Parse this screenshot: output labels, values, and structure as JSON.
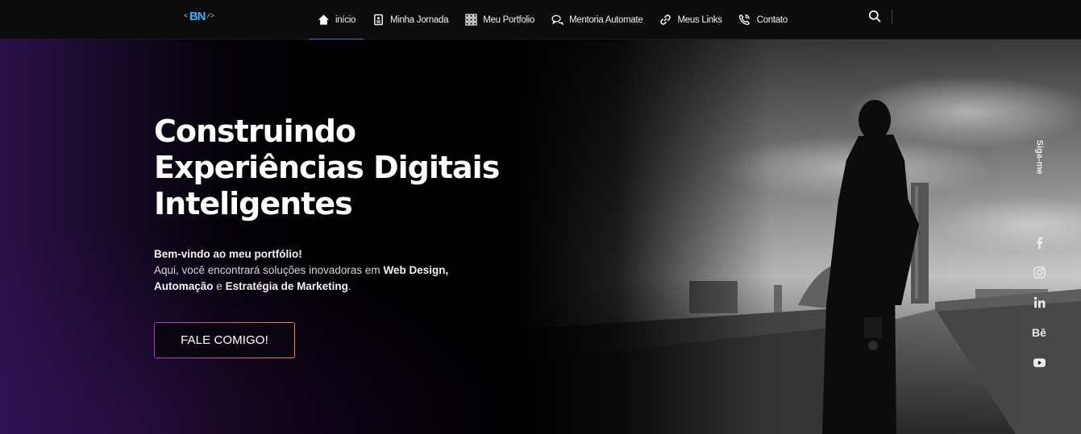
{
  "logo": {
    "left_bracket": "<",
    "mark": "BN",
    "right_bracket": "/>"
  },
  "nav": {
    "items": [
      {
        "label": "início",
        "icon": "home-icon"
      },
      {
        "label": "Minha Jornada",
        "icon": "id-card-icon"
      },
      {
        "label": "Meu Portfolio",
        "icon": "grid-icon"
      },
      {
        "label": "Mentoria Automate",
        "icon": "chat-icon"
      },
      {
        "label": "Meus Links",
        "icon": "link-icon"
      },
      {
        "label": "Contato",
        "icon": "phone-icon"
      }
    ],
    "active_index": 0,
    "accent": "#3d6fe0"
  },
  "hero": {
    "headline_lines": [
      "Construindo",
      "Experiências Digitais",
      "Inteligentes"
    ],
    "intro_welcome": "Bem-vindo ao meu portfólio!",
    "intro_text": "Aqui, você encontrará soluções inovadoras em",
    "intro_highlight_1": "Web Design,",
    "intro_highlight_2": "Automação",
    "intro_and": "e",
    "intro_highlight_3": "Estratégia de Marketing",
    "intro_end": ".",
    "cta_label": "FALE COMIGO!"
  },
  "social": {
    "follow_label": "Siga-me",
    "items": [
      {
        "name": "facebook-icon"
      },
      {
        "name": "instagram-icon"
      },
      {
        "name": "linkedin-icon"
      },
      {
        "name": "behance-icon",
        "text": "Bē"
      },
      {
        "name": "youtube-icon"
      }
    ]
  },
  "colors": {
    "background": "#000000",
    "purple_glow": "#2a1148",
    "cta_gradient": [
      "#b02fd6",
      "#ff7a3c"
    ]
  }
}
